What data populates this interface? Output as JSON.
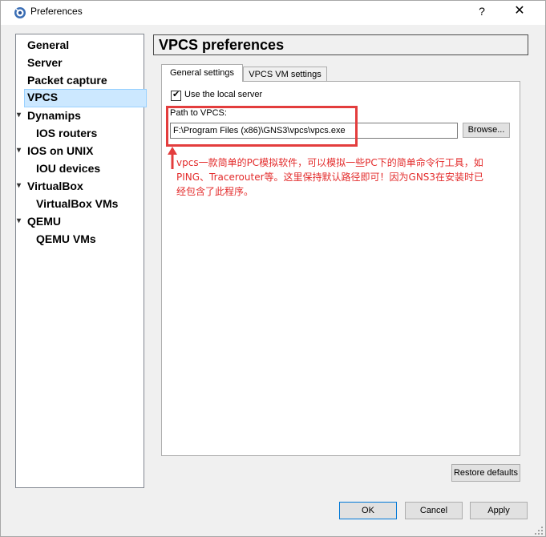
{
  "window": {
    "title": "Preferences",
    "help_label": "?",
    "close_label": "✕"
  },
  "sidebar": {
    "items": [
      {
        "label": "General",
        "level": 0,
        "expandable": false
      },
      {
        "label": "Server",
        "level": 0,
        "expandable": false
      },
      {
        "label": "Packet capture",
        "level": 0,
        "expandable": false
      },
      {
        "label": "VPCS",
        "level": 0,
        "expandable": false,
        "selected": true
      },
      {
        "label": "Dynamips",
        "level": 0,
        "expandable": true,
        "expanded": true
      },
      {
        "label": "IOS routers",
        "level": 1,
        "expandable": false
      },
      {
        "label": "IOS on UNIX",
        "level": 0,
        "expandable": true,
        "expanded": true
      },
      {
        "label": "IOU devices",
        "level": 1,
        "expandable": false
      },
      {
        "label": "VirtualBox",
        "level": 0,
        "expandable": true,
        "expanded": true
      },
      {
        "label": "VirtualBox VMs",
        "level": 1,
        "expandable": false
      },
      {
        "label": "QEMU",
        "level": 0,
        "expandable": true,
        "expanded": true
      },
      {
        "label": "QEMU VMs",
        "level": 1,
        "expandable": false
      }
    ],
    "expanded_arrow": "▾"
  },
  "page": {
    "title": "VPCS preferences",
    "tabs": [
      {
        "label": "General settings",
        "active": true
      },
      {
        "label": "VPCS VM settings",
        "active": false
      }
    ],
    "use_local_server": {
      "label": "Use the local server",
      "checked": true,
      "check_glyph": "✔"
    },
    "path_label": "Path to VPCS:",
    "path_value": "F:\\Program Files (x86)\\GNS3\\vpcs\\vpcs.exe",
    "browse_label": "Browse...",
    "annotation": "vpcs一款简单的PC模拟软件，可以模拟一些PC下的简单命令行工具，如PING、Tracerouter等。这里保持默认路径即可！因为GNS3在安装时已经包含了此程序。",
    "annotation_color": "#e32b2b"
  },
  "footer": {
    "restore_label": "Restore defaults",
    "ok_label": "OK",
    "cancel_label": "Cancel",
    "apply_label": "Apply"
  },
  "colors": {
    "selection_bg": "#cce8ff",
    "highlight_border": "#e33d3d",
    "default_button_border": "#0078d7"
  }
}
